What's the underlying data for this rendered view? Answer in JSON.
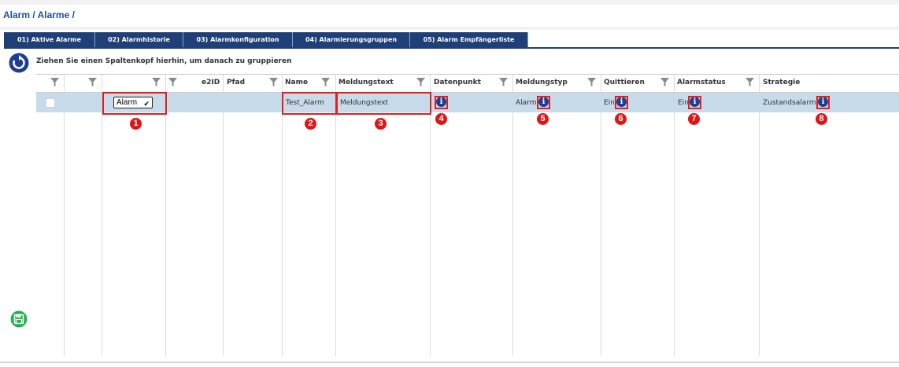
{
  "breadcrumb": "Alarm / Alarme /",
  "tabs": [
    {
      "label": "01) Aktive Alarme"
    },
    {
      "label": "02) Alarmhistorie"
    },
    {
      "label": "03) Alarmkonfiguration"
    },
    {
      "label": "04) Alarmierungsgruppen"
    },
    {
      "label": "05) Alarm Empfängerliste"
    }
  ],
  "grid": {
    "group_hint": "Ziehen Sie einen Spaltenkopf hierhin, um danach zu gruppieren",
    "columns": [
      "",
      "",
      "",
      "e2ID",
      "Pfad",
      "Name",
      "Meldungstext",
      "Datenpunkt",
      "Meldungstyp",
      "Quittieren",
      "Alarmstatus",
      "Strategie"
    ],
    "row": {
      "type_select": "Alarm",
      "name": "Test_Alarm",
      "meldungstext": "Meldungstext",
      "meldungstyp": "Alarm",
      "quittieren": "Ein",
      "alarmstatus": "Ein",
      "strategie": "Zustandsalarm"
    }
  },
  "annotations": [
    "1",
    "2",
    "3",
    "4",
    "5",
    "6",
    "7",
    "8"
  ],
  "icons": {
    "refresh": "refresh-icon",
    "save": "save-icon",
    "filter": "filter-icon",
    "info": "info-icon"
  },
  "colors": {
    "tab_bg": "#1e3f78",
    "selected_row": "#c7dbea",
    "annotation_red": "#e01515",
    "info_blue": "#1c3f94",
    "save_green": "#22b14c"
  }
}
